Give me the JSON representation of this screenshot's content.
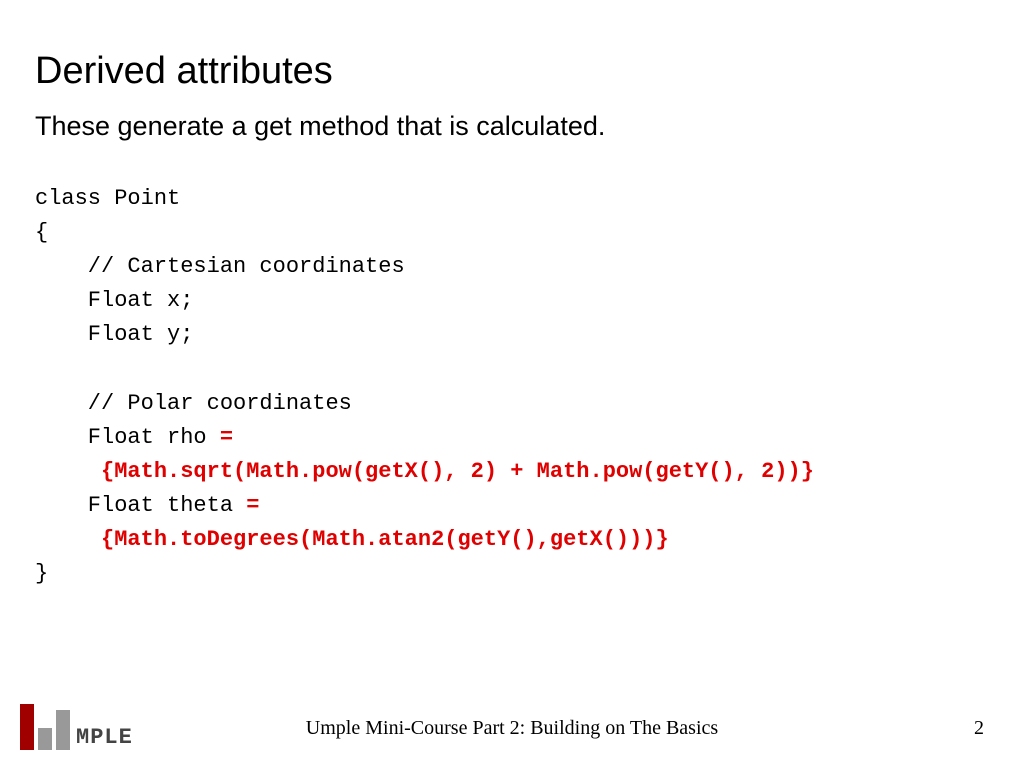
{
  "title": "Derived attributes",
  "subtitle": "These generate a get method that is calculated.",
  "code": {
    "l1": "class Point",
    "l2": "{",
    "l3": "    // Cartesian coordinates",
    "l4": "    Float x;",
    "l5": "    Float y;",
    "l6": "",
    "l7": "    // Polar coordinates",
    "l8a": "    Float rho ",
    "eq1": "=",
    "l9": "     {Math.sqrt(Math.pow(getX(), 2) + Math.pow(getY(), 2))}",
    "l10a": "    Float theta ",
    "eq2": "=",
    "l11": "     {Math.toDegrees(Math.atan2(getY(),getX()))}",
    "l12": "}"
  },
  "logo_text": "MPLE",
  "footer": "Umple Mini-Course Part 2: Building on The Basics",
  "page": "2"
}
